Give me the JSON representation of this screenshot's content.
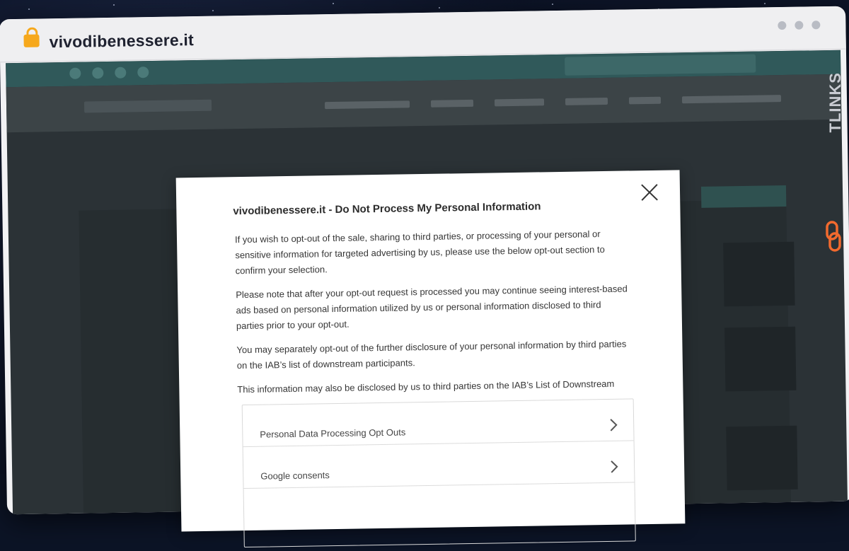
{
  "browser": {
    "url": "vivodibenessere.it"
  },
  "sidebar_brand": {
    "text": "TLINKS"
  },
  "modal": {
    "title": "vivodibenessere.it - Do Not Process My Personal Information",
    "paragraphs": [
      "If you wish to opt-out of the sale, sharing to third parties, or processing of your personal or sensitive information for targeted advertising by us, please use the below opt-out section to confirm your selection.",
      "Please note that after your opt-out request is processed you may continue seeing interest-based ads based on personal information utilized by us or personal information disclosed to third parties prior to your opt-out.",
      "You may separately opt-out of the further disclosure of your personal information by third parties on the IAB’s list of downstream participants.",
      "This information may also be disclosed by us to third parties on the IAB’s List of Downstream"
    ],
    "options": [
      {
        "label": "Personal Data Processing Opt Outs"
      },
      {
        "label": "Google consents"
      }
    ]
  },
  "colors": {
    "accent_orange": "#f26a2e",
    "lock": "#f6a81c"
  }
}
